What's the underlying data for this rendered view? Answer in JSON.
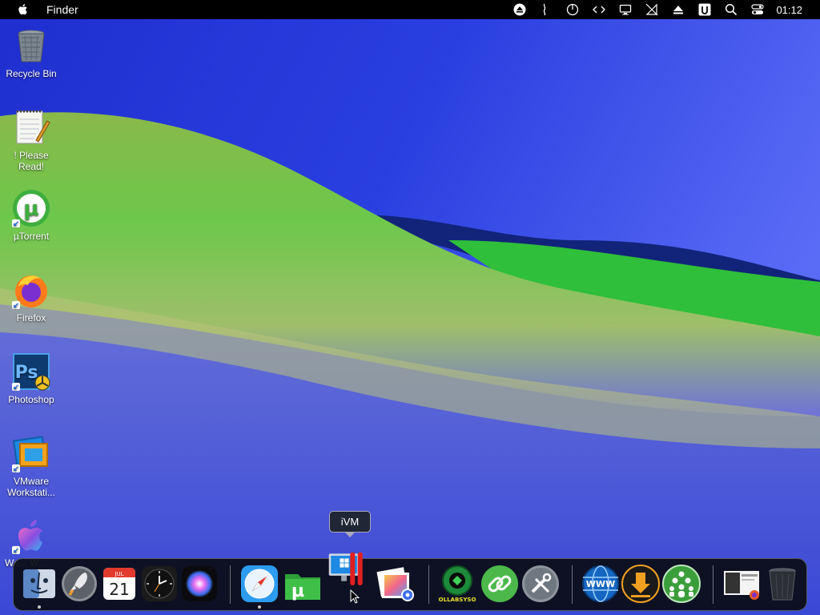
{
  "menubar": {
    "app_name": "Finder",
    "clock": "01:12",
    "icons": [
      "apple-icon",
      "eject-icon",
      "battery-icon",
      "power-icon",
      "code-icon",
      "display-icon",
      "network-off-icon",
      "upload-icon",
      "u-app-icon",
      "search-icon",
      "control-center-icon"
    ]
  },
  "desktop": {
    "icons": [
      {
        "label": "Recycle Bin",
        "icon": "recycle-bin-icon"
      },
      {
        "label": "! Please Read!",
        "icon": "notepad-icon"
      },
      {
        "label": "µTorrent",
        "icon": "utorrent-icon"
      },
      {
        "label": "Firefox",
        "icon": "firefox-icon"
      },
      {
        "label": "Photoshop",
        "icon": "photoshop-icon"
      },
      {
        "label": "VMware Workstati...",
        "icon": "vmware-icon"
      },
      {
        "label": "We... W...",
        "icon": "apple-logo-icon"
      }
    ]
  },
  "tooltip": {
    "text": "iVM"
  },
  "dock": {
    "calendar": {
      "month": "JUL",
      "day": "21"
    },
    "items": [
      "finder-icon",
      "launchpad-icon",
      "calendar-icon",
      "clock-icon",
      "siri-icon",
      "safari-icon",
      "utorrent-folder-icon",
      "ivm-icon",
      "photos-icon",
      "collabsysos-icon",
      "link-icon",
      "tools-icon",
      "www-icon",
      "download-icon",
      "people-icon",
      "screenshot-icon",
      "trash-icon"
    ],
    "collabsysos_label": "COLLABSYSOS",
    "www_label": "WWW",
    "photoshop_badge": "Ps",
    "colors": {
      "accent": "#1e88e5",
      "green": "#3fae3f",
      "dock_bg": "#0a0c14"
    }
  }
}
